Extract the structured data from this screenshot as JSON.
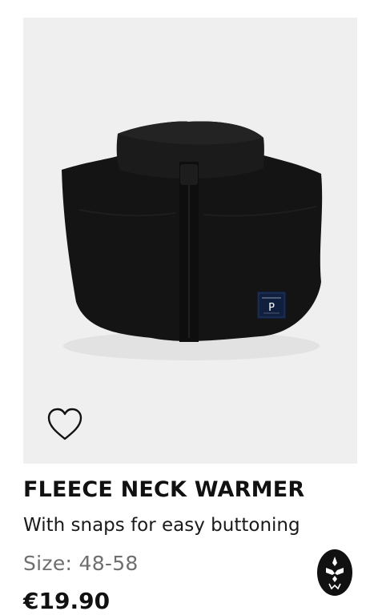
{
  "product": {
    "title": "FLEECE NECK WARMER",
    "subtitle": "With snaps for easy buttoning",
    "size": "Size: 48-58",
    "price": "€19.90",
    "label_letter": "P"
  },
  "icons": {
    "wishlist": "heart-outline-icon",
    "brand": "brand-logo-icon"
  },
  "colors": {
    "image_background": "#efefef",
    "garment": "#111111",
    "label_background": "#0f1f3d",
    "text_primary": "#111111",
    "text_muted": "#6f6f6f",
    "badge_background": "#111111"
  }
}
